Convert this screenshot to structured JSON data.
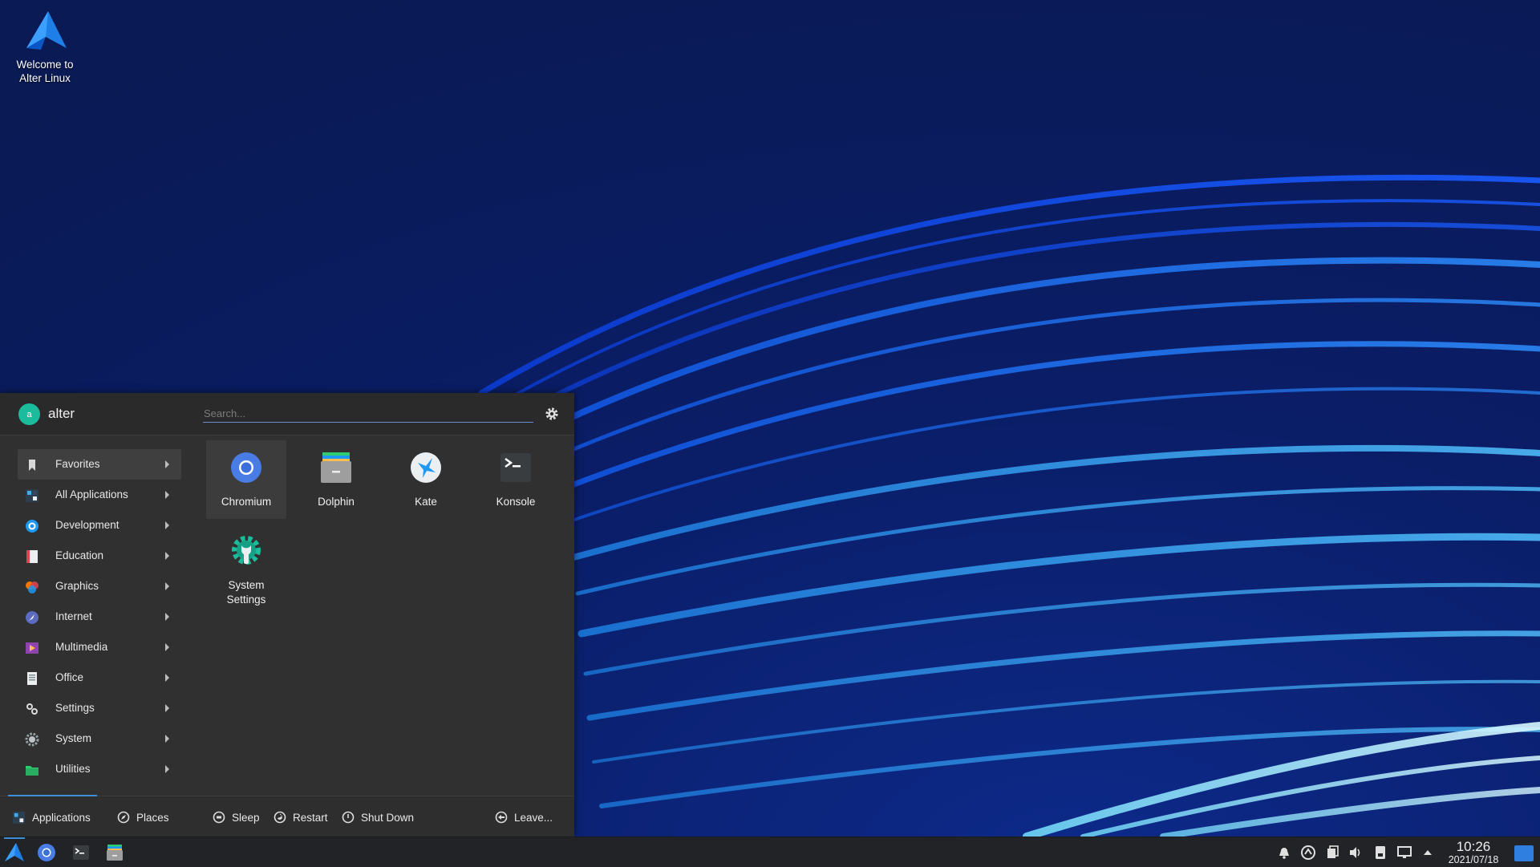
{
  "desktop": {
    "icon": {
      "label_line1": "Welcome to",
      "label_line2": "Alter Linux",
      "icon": "alter-logo-icon"
    }
  },
  "launcher": {
    "user": {
      "avatar_letter": "a",
      "name": "alter"
    },
    "search": {
      "placeholder": "Search...",
      "value": ""
    },
    "settings_icon": "gear-icon",
    "categories": [
      {
        "label": "Favorites",
        "icon": "bookmark-icon",
        "active": true
      },
      {
        "label": "All Applications",
        "icon": "all-apps-icon"
      },
      {
        "label": "Development",
        "icon": "development-icon"
      },
      {
        "label": "Education",
        "icon": "education-icon"
      },
      {
        "label": "Graphics",
        "icon": "graphics-icon"
      },
      {
        "label": "Internet",
        "icon": "internet-icon"
      },
      {
        "label": "Multimedia",
        "icon": "multimedia-icon"
      },
      {
        "label": "Office",
        "icon": "office-icon"
      },
      {
        "label": "Settings",
        "icon": "settings-icon"
      },
      {
        "label": "System",
        "icon": "system-icon"
      },
      {
        "label": "Utilities",
        "icon": "utilities-icon"
      }
    ],
    "favorites": [
      {
        "label": "Chromium",
        "icon": "chromium-icon",
        "selected": true
      },
      {
        "label": "Dolphin",
        "icon": "dolphin-icon"
      },
      {
        "label": "Kate",
        "icon": "kate-icon"
      },
      {
        "label": "Konsole",
        "icon": "konsole-icon"
      },
      {
        "label_line1": "System",
        "label_line2": "Settings",
        "icon": "system-settings-icon"
      }
    ],
    "bottom": {
      "applications": "Applications",
      "places": "Places",
      "sleep": "Sleep",
      "restart": "Restart",
      "shutdown": "Shut Down",
      "leave": "Leave..."
    }
  },
  "taskbar": {
    "launchers": [
      "alter-logo-icon",
      "chromium-icon",
      "konsole-icon",
      "dolphin-icon"
    ],
    "tray": [
      "notifications-icon",
      "update-icon",
      "clipboard-icon",
      "volume-icon",
      "device-icon",
      "display-icon",
      "expand-arrow-icon"
    ],
    "clock": {
      "time": "10:26",
      "date": "2021/07/18"
    },
    "colors": {
      "accent": "#3d8fd6",
      "panel": "#222326",
      "launcher_bg": "#303030"
    }
  }
}
